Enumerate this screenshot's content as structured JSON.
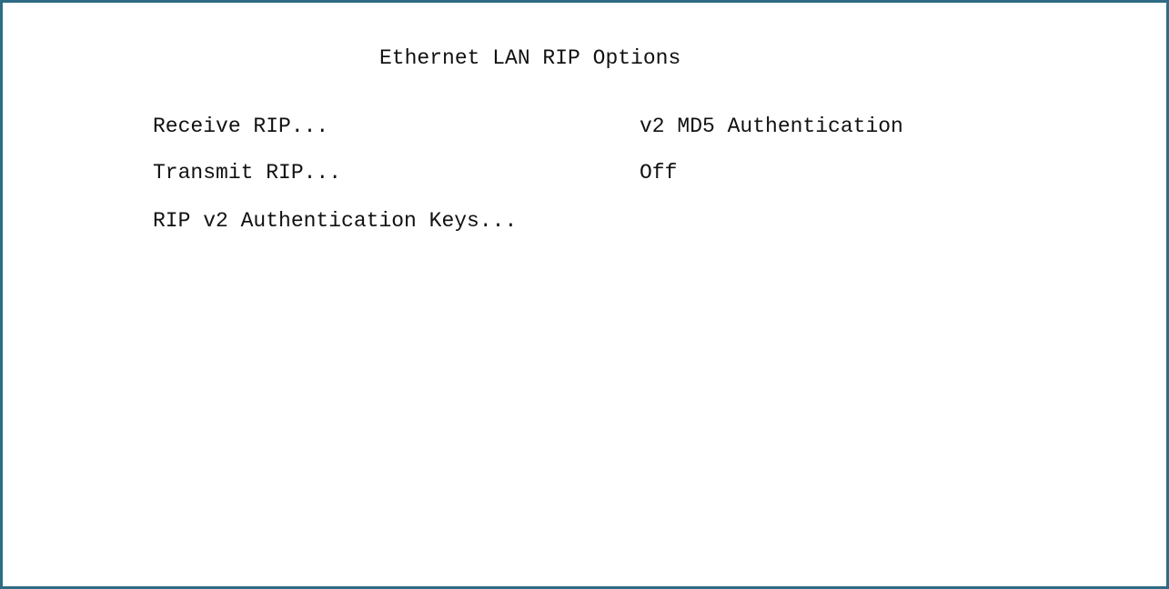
{
  "screen": {
    "title": "Ethernet LAN RIP Options"
  },
  "menu": {
    "items": [
      {
        "label": "Receive RIP...",
        "value": "v2 MD5 Authentication"
      },
      {
        "label": "Transmit RIP...",
        "value": "Off"
      },
      {
        "label": "RIP v2 Authentication Keys...",
        "value": ""
      }
    ]
  },
  "colors": {
    "frame_border": "#2f6b84",
    "background": "#ffffff",
    "text": "#111111"
  }
}
